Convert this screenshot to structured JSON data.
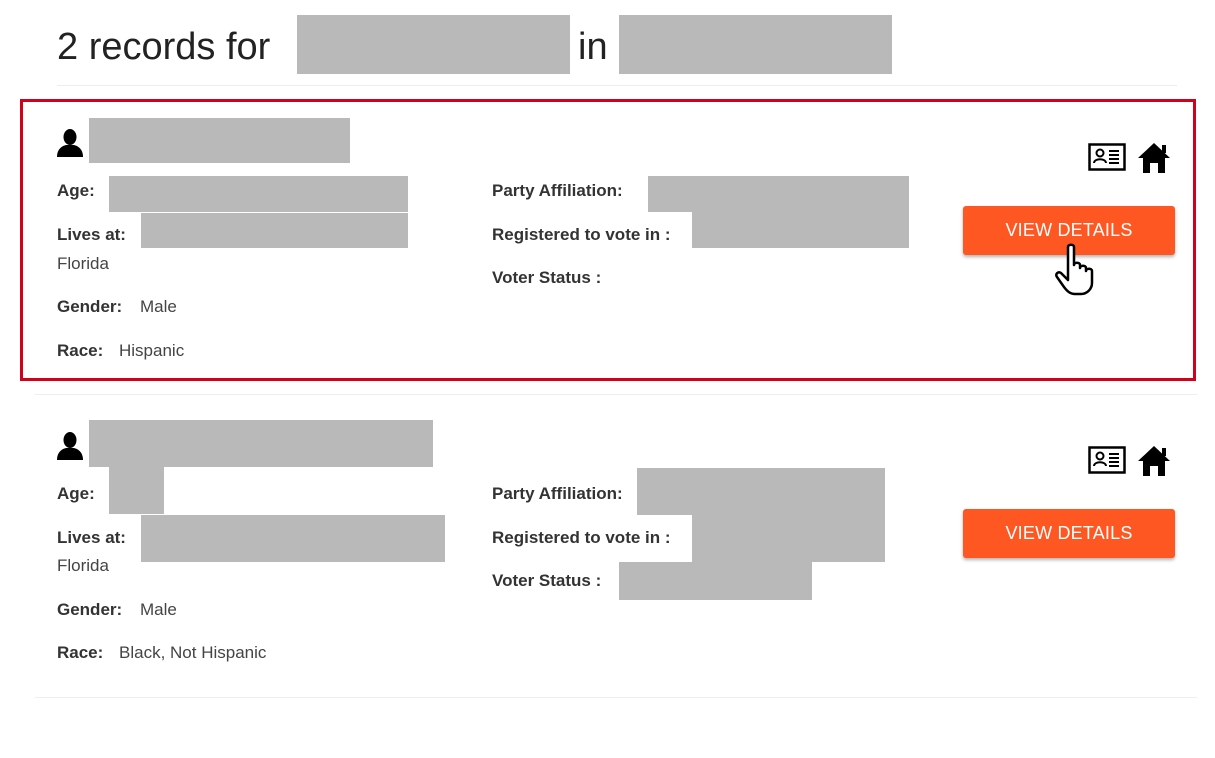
{
  "header": {
    "count_text": "2 records for",
    "in_text": "in"
  },
  "records": [
    {
      "labels": {
        "age": "Age:",
        "lives_at": "Lives at:",
        "gender": "Gender:",
        "race": "Race:",
        "party": "Party Affiliation:",
        "registered": "Registered to vote in :",
        "voter_status": "Voter Status :"
      },
      "state": "Florida",
      "gender": "Male",
      "race": "Hispanic",
      "icons": [
        "person-icon",
        "id-card-icon",
        "home-icon"
      ],
      "button_label": "VIEW DETAILS",
      "highlighted": true
    },
    {
      "labels": {
        "age": "Age:",
        "lives_at": "Lives at:",
        "gender": "Gender:",
        "race": "Race:",
        "party": "Party Affiliation:",
        "registered": "Registered to vote in :",
        "voter_status": "Voter Status :"
      },
      "state": "Florida",
      "gender": "Male",
      "race": "Black, Not Hispanic",
      "icons": [
        "person-icon",
        "id-card-icon",
        "home-icon"
      ],
      "button_label": "VIEW DETAILS",
      "highlighted": false
    }
  ],
  "colors": {
    "accent": "#ff5722",
    "highlight_border": "#d0021b",
    "redaction": "#b9b9b9"
  }
}
